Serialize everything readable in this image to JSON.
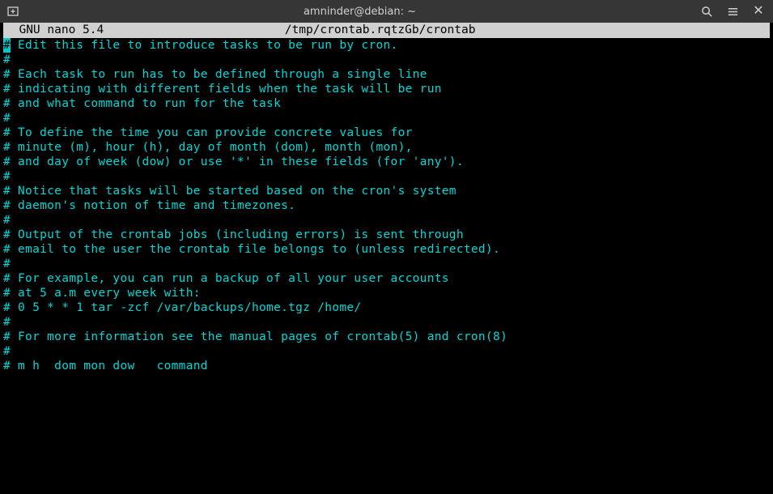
{
  "titlebar": {
    "title": "amninder@debian: ~"
  },
  "nano": {
    "app_name": "  GNU nano 5.4",
    "file_path": "/tmp/crontab.rqtzGb/crontab"
  },
  "lines": [
    " Edit this file to introduce tasks to be run by cron.",
    "",
    " Each task to run has to be defined through a single line",
    " indicating with different fields when the task will be run",
    " and what command to run for the task",
    "",
    " To define the time you can provide concrete values for",
    " minute (m), hour (h), day of month (dom), month (mon),",
    " and day of week (dow) or use '*' in these fields (for 'any').",
    "",
    " Notice that tasks will be started based on the cron's system",
    " daemon's notion of time and timezones.",
    "",
    " Output of the crontab jobs (including errors) is sent through",
    " email to the user the crontab file belongs to (unless redirected).",
    "",
    " For example, you can run a backup of all your user accounts",
    " at 5 a.m every week with:",
    " 0 5 * * 1 tar -zcf /var/backups/home.tgz /home/",
    "",
    " For more information see the manual pages of crontab(5) and cron(8)",
    "",
    " m h  dom mon dow   command"
  ]
}
